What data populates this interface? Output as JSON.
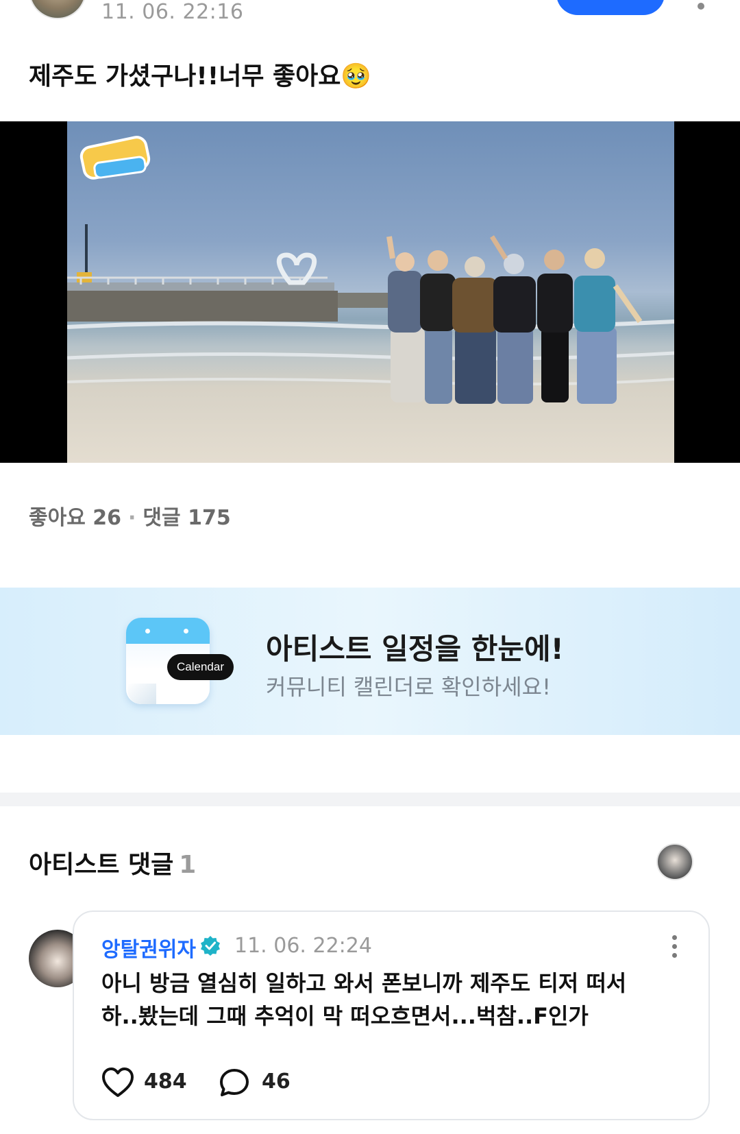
{
  "post": {
    "timestamp": "11. 06. 22:16",
    "text": "제주도 가셨구나!!너무 좋아요🥹"
  },
  "stats": {
    "likes_label": "좋아요",
    "likes_count": "26",
    "separator": "·",
    "comments_label": "댓글",
    "comments_count": "175"
  },
  "banner": {
    "pill_label": "Calendar",
    "title": "아티스트 일정을 한눈에!",
    "subtitle": "커뮤니티 캘린더로 확인하세요!"
  },
  "artist_comments": {
    "title": "아티스트 댓글",
    "count": "1"
  },
  "comment": {
    "author": "앙탈권위자",
    "timestamp": "11. 06. 22:24",
    "text_line1": "아니 방금 열심히 일하고 와서 폰보니까 제주도 티저 떠서",
    "text_line2": "하..봤는데 그때 추억이 막 떠오흐면서...벅참..F인가",
    "likes": "484",
    "replies": "46"
  },
  "colors": {
    "accent_blue": "#1e6bff",
    "verified_teal": "#1fb3c8"
  }
}
